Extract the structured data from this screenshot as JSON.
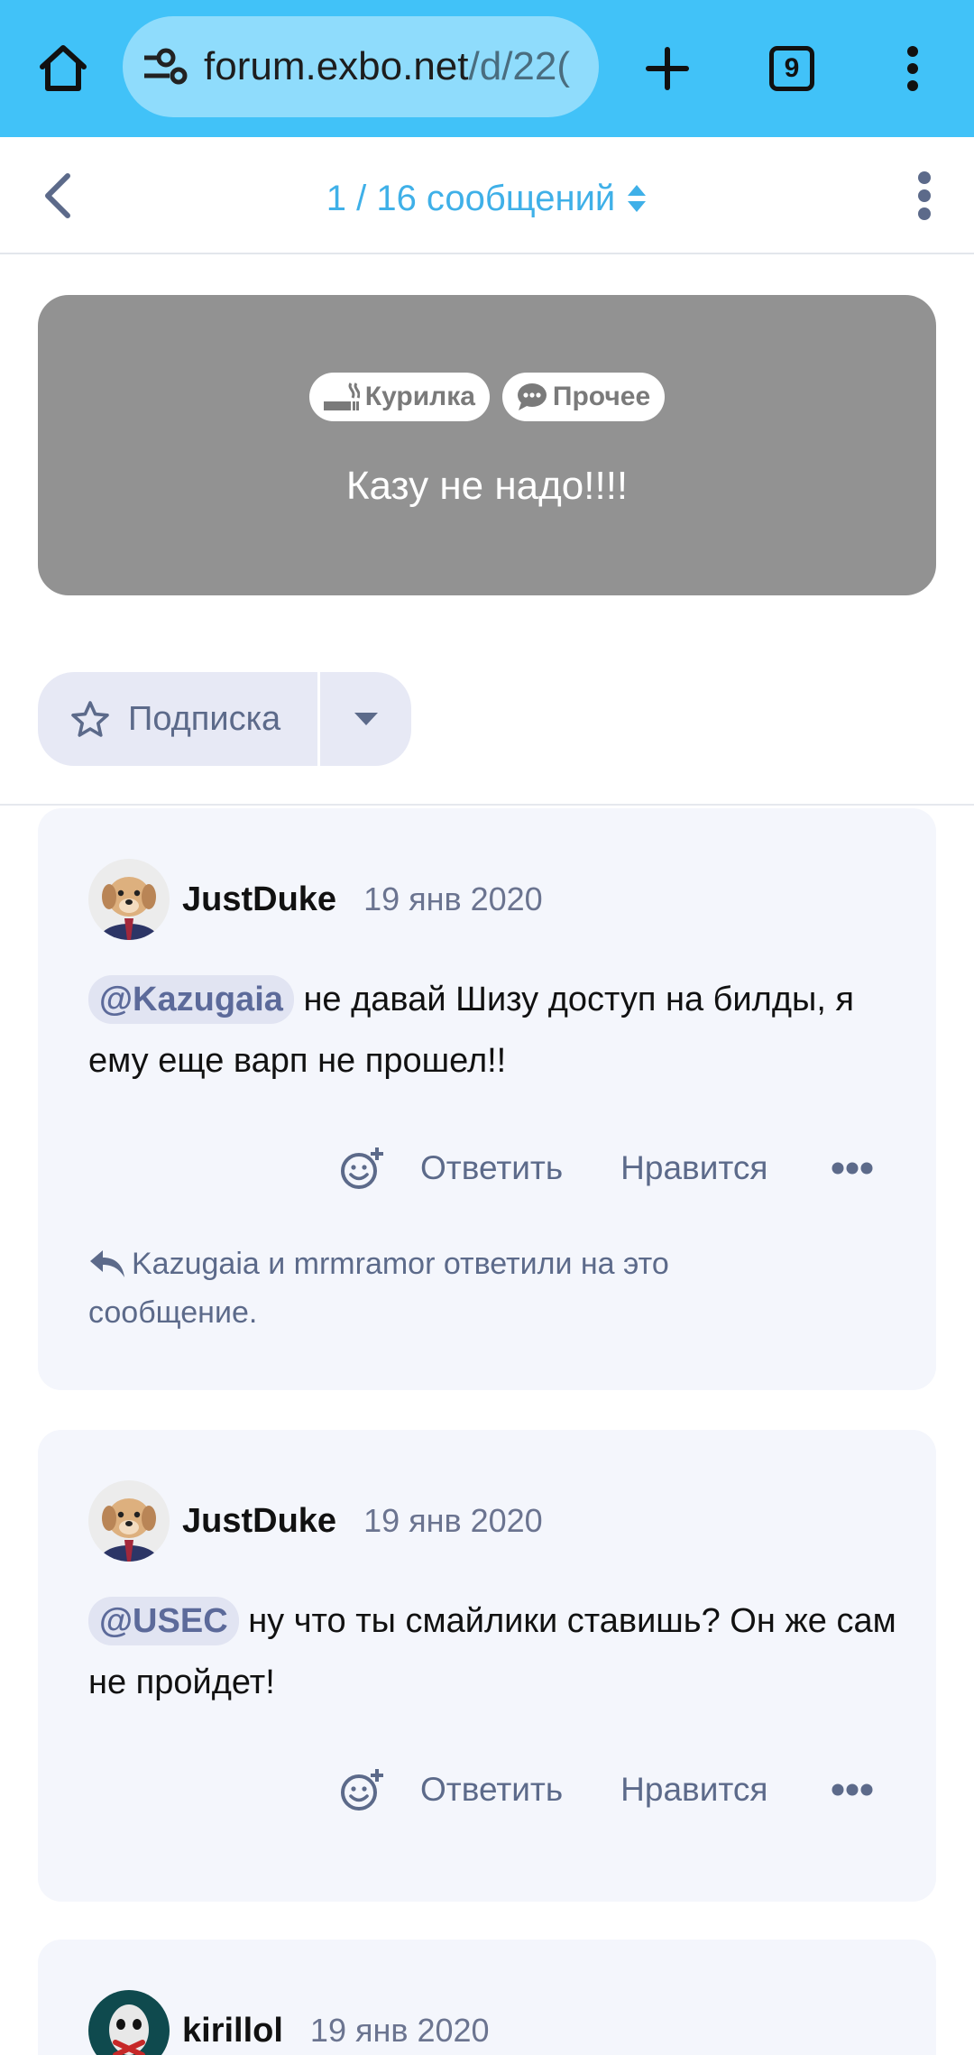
{
  "browser": {
    "url_host": "forum.exbo.net",
    "url_path": "/d/22(",
    "tab_count": "9",
    "address_bar_color": "#41c2f8"
  },
  "header": {
    "counter": "1 / 16 сообщений"
  },
  "discussion": {
    "tags": [
      {
        "label": "Курилка",
        "icon": "smoking-icon"
      },
      {
        "label": "Прочее",
        "icon": "comment-icon"
      }
    ],
    "title": "Казу не надо!!!!",
    "hero_color": "#929292"
  },
  "subscribe": {
    "label": "Подписка"
  },
  "posts": [
    {
      "author": "JustDuke",
      "date": "19 янв 2020",
      "mention": "@Kazugaia",
      "text": " не давай Шизу доступ на билды, я ему еще варп не прошел!!",
      "actions": {
        "reply": "Ответить",
        "like": "Нравится"
      },
      "replied_note": "Kazugaia и mrmramor ответили на это сообщение."
    },
    {
      "author": "JustDuke",
      "date": "19 янв 2020",
      "mention": "@USEC",
      "text": " ну что ты смайлики ставишь? Он же сам не пройдет!",
      "actions": {
        "reply": "Ответить",
        "like": "Нравится"
      }
    },
    {
      "author": "kirillol",
      "date": "19 янв 2020"
    }
  ]
}
